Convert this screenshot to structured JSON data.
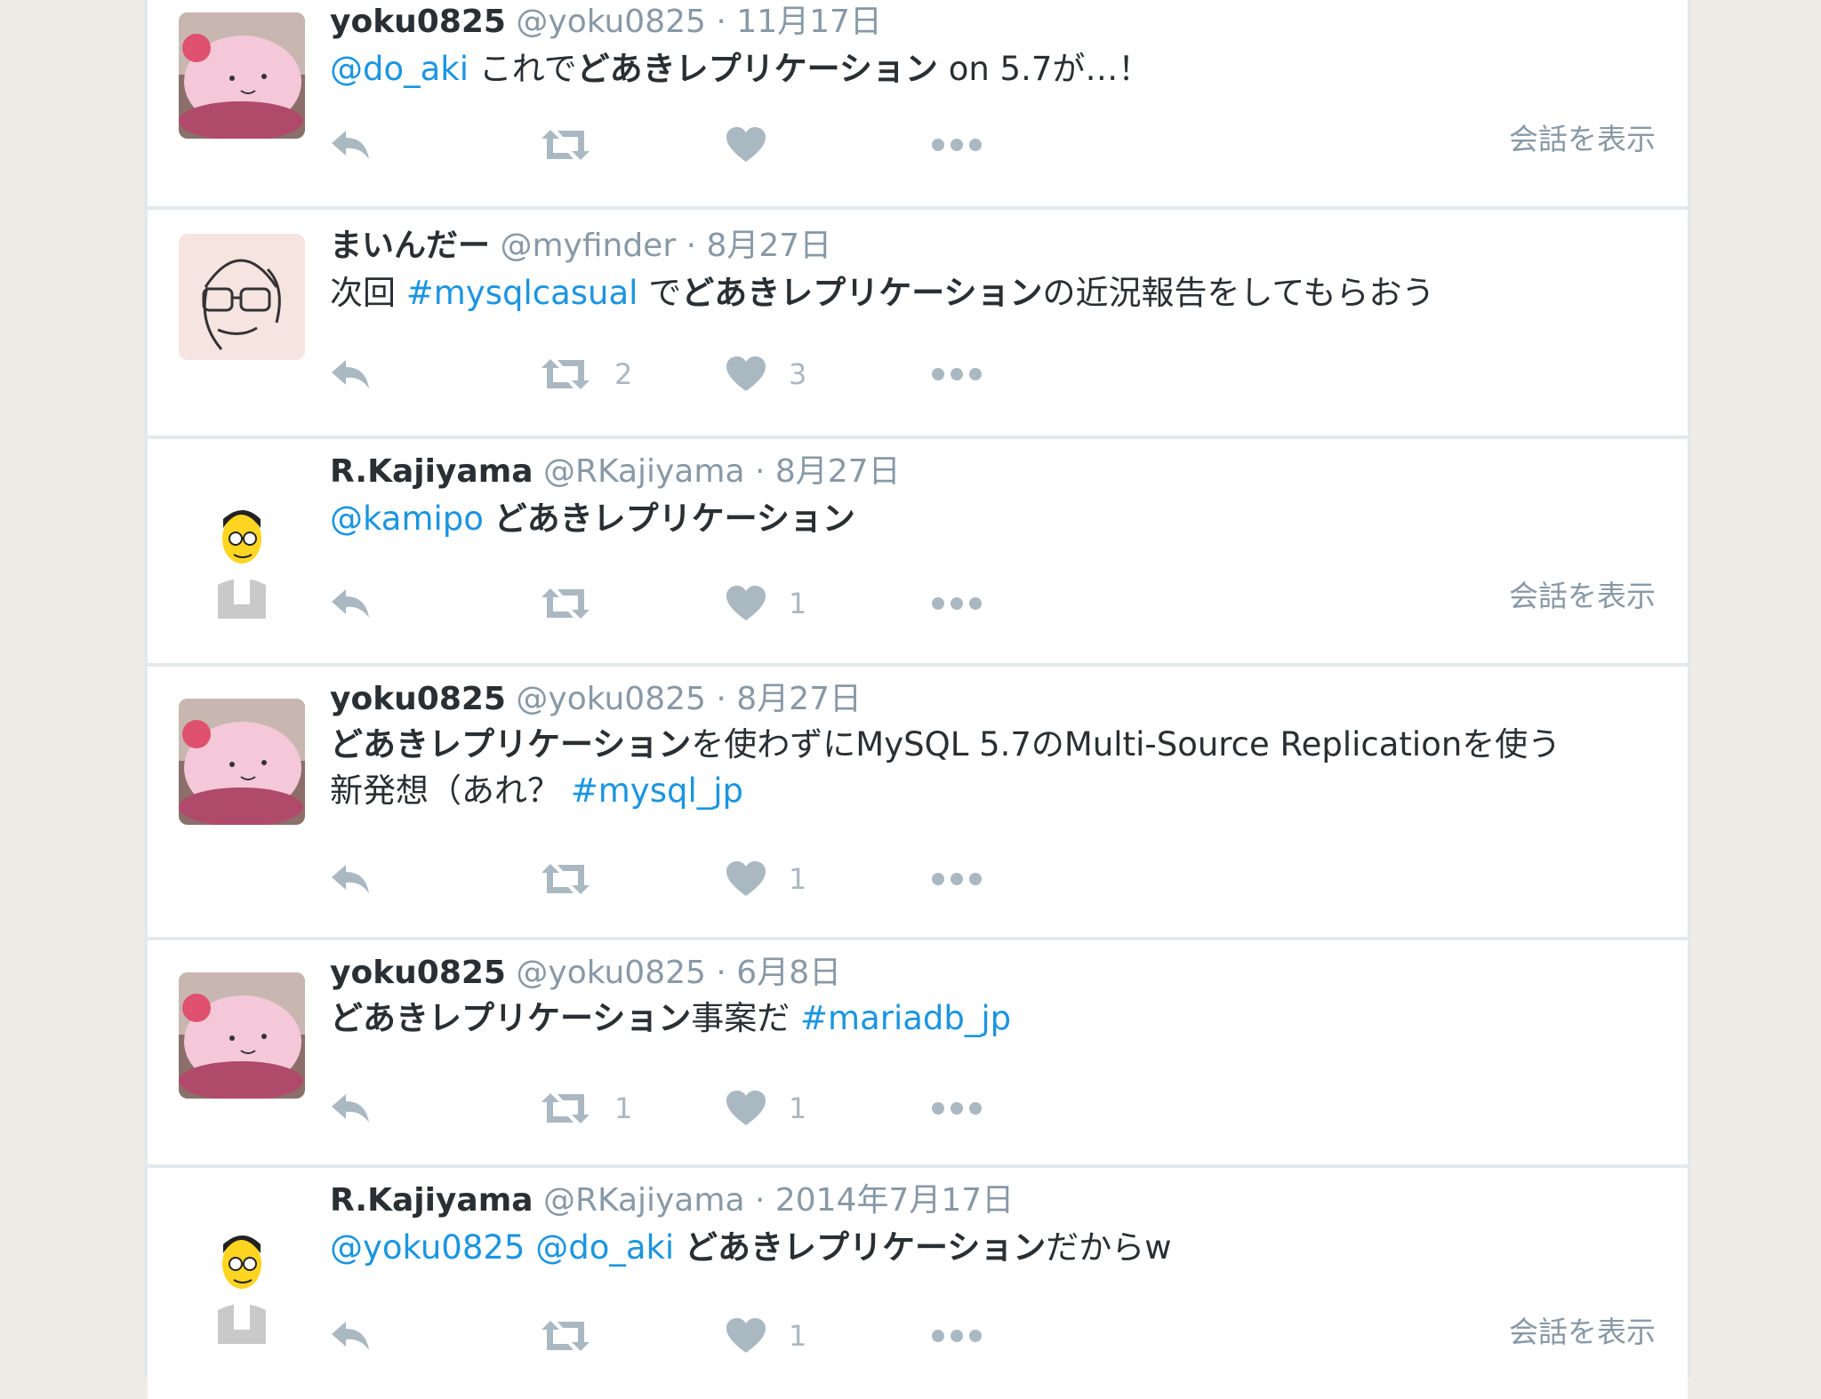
{
  "colors": {
    "page_background": "#efebe6",
    "timeline_background": "#e3e9ec",
    "card_background": "#ffffff",
    "name": "#292f33",
    "meta": "#8899a6",
    "link": "#1b95e0",
    "icon": "#aab8c2"
  },
  "icons": {
    "reply": "reply-icon",
    "retweet": "retweet-icon",
    "like": "heart-icon",
    "more": "more-icon"
  },
  "tweets": [
    {
      "avatar": "pink-blob-avatar",
      "name": "yoku0825",
      "handle": "@yoku0825",
      "separator": "·",
      "date": "11月17日",
      "text_parts": [
        {
          "text": "@do_aki",
          "kind": "link"
        },
        {
          "text": " これで",
          "kind": "plain"
        },
        {
          "text": "どあきレプリケーション",
          "kind": "bold"
        },
        {
          "text": " on 5.7が…！",
          "kind": "plain"
        }
      ],
      "retweet_count": "",
      "like_count": "",
      "conversation_link": "会話を表示"
    },
    {
      "avatar": "sketch-face-avatar",
      "name": "まいんだー",
      "handle": "@myfinder",
      "separator": "·",
      "date": "8月27日",
      "text_parts": [
        {
          "text": "次回 ",
          "kind": "plain"
        },
        {
          "text": "#mysqlcasual",
          "kind": "link"
        },
        {
          "text": " で",
          "kind": "plain"
        },
        {
          "text": "どあきレプリケーション",
          "kind": "bold"
        },
        {
          "text": "の近況報告をしてもらおう",
          "kind": "plain"
        }
      ],
      "retweet_count": "2",
      "like_count": "3",
      "conversation_link": ""
    },
    {
      "avatar": "cartoon-man-avatar",
      "name": "R.Kajiyama",
      "handle": "@RKajiyama",
      "separator": "·",
      "date": "8月27日",
      "text_parts": [
        {
          "text": "@kamipo",
          "kind": "link"
        },
        {
          "text": " ",
          "kind": "plain"
        },
        {
          "text": "どあきレプリケーション",
          "kind": "bold"
        }
      ],
      "retweet_count": "",
      "like_count": "1",
      "conversation_link": "会話を表示"
    },
    {
      "avatar": "pink-blob-avatar",
      "name": "yoku0825",
      "handle": "@yoku0825",
      "separator": "·",
      "date": "8月27日",
      "text_parts": [
        {
          "text": "どあきレプリケーション",
          "kind": "bold"
        },
        {
          "text": "を使わずにMySQL 5.7のMulti-Source Replicationを使う",
          "kind": "plain"
        },
        {
          "text": "\n",
          "kind": "break"
        },
        {
          "text": "新発想（あれ？ ",
          "kind": "plain"
        },
        {
          "text": "#mysql_jp",
          "kind": "link"
        }
      ],
      "retweet_count": "",
      "like_count": "1",
      "conversation_link": ""
    },
    {
      "avatar": "pink-blob-avatar",
      "name": "yoku0825",
      "handle": "@yoku0825",
      "separator": "·",
      "date": "6月8日",
      "text_parts": [
        {
          "text": "どあきレプリケーション",
          "kind": "bold"
        },
        {
          "text": "事案だ ",
          "kind": "plain"
        },
        {
          "text": "#mariadb_jp",
          "kind": "link"
        }
      ],
      "retweet_count": "1",
      "like_count": "1",
      "conversation_link": ""
    },
    {
      "avatar": "cartoon-man-avatar",
      "name": "R.Kajiyama",
      "handle": "@RKajiyama",
      "separator": "·",
      "date": "2014年7月17日",
      "text_parts": [
        {
          "text": "@yoku0825",
          "kind": "link"
        },
        {
          "text": " ",
          "kind": "plain"
        },
        {
          "text": "@do_aki",
          "kind": "link"
        },
        {
          "text": " ",
          "kind": "plain"
        },
        {
          "text": "どあきレプリケーション",
          "kind": "bold"
        },
        {
          "text": "だからw",
          "kind": "plain"
        }
      ],
      "retweet_count": "",
      "like_count": "1",
      "conversation_link": "会話を表示"
    }
  ]
}
